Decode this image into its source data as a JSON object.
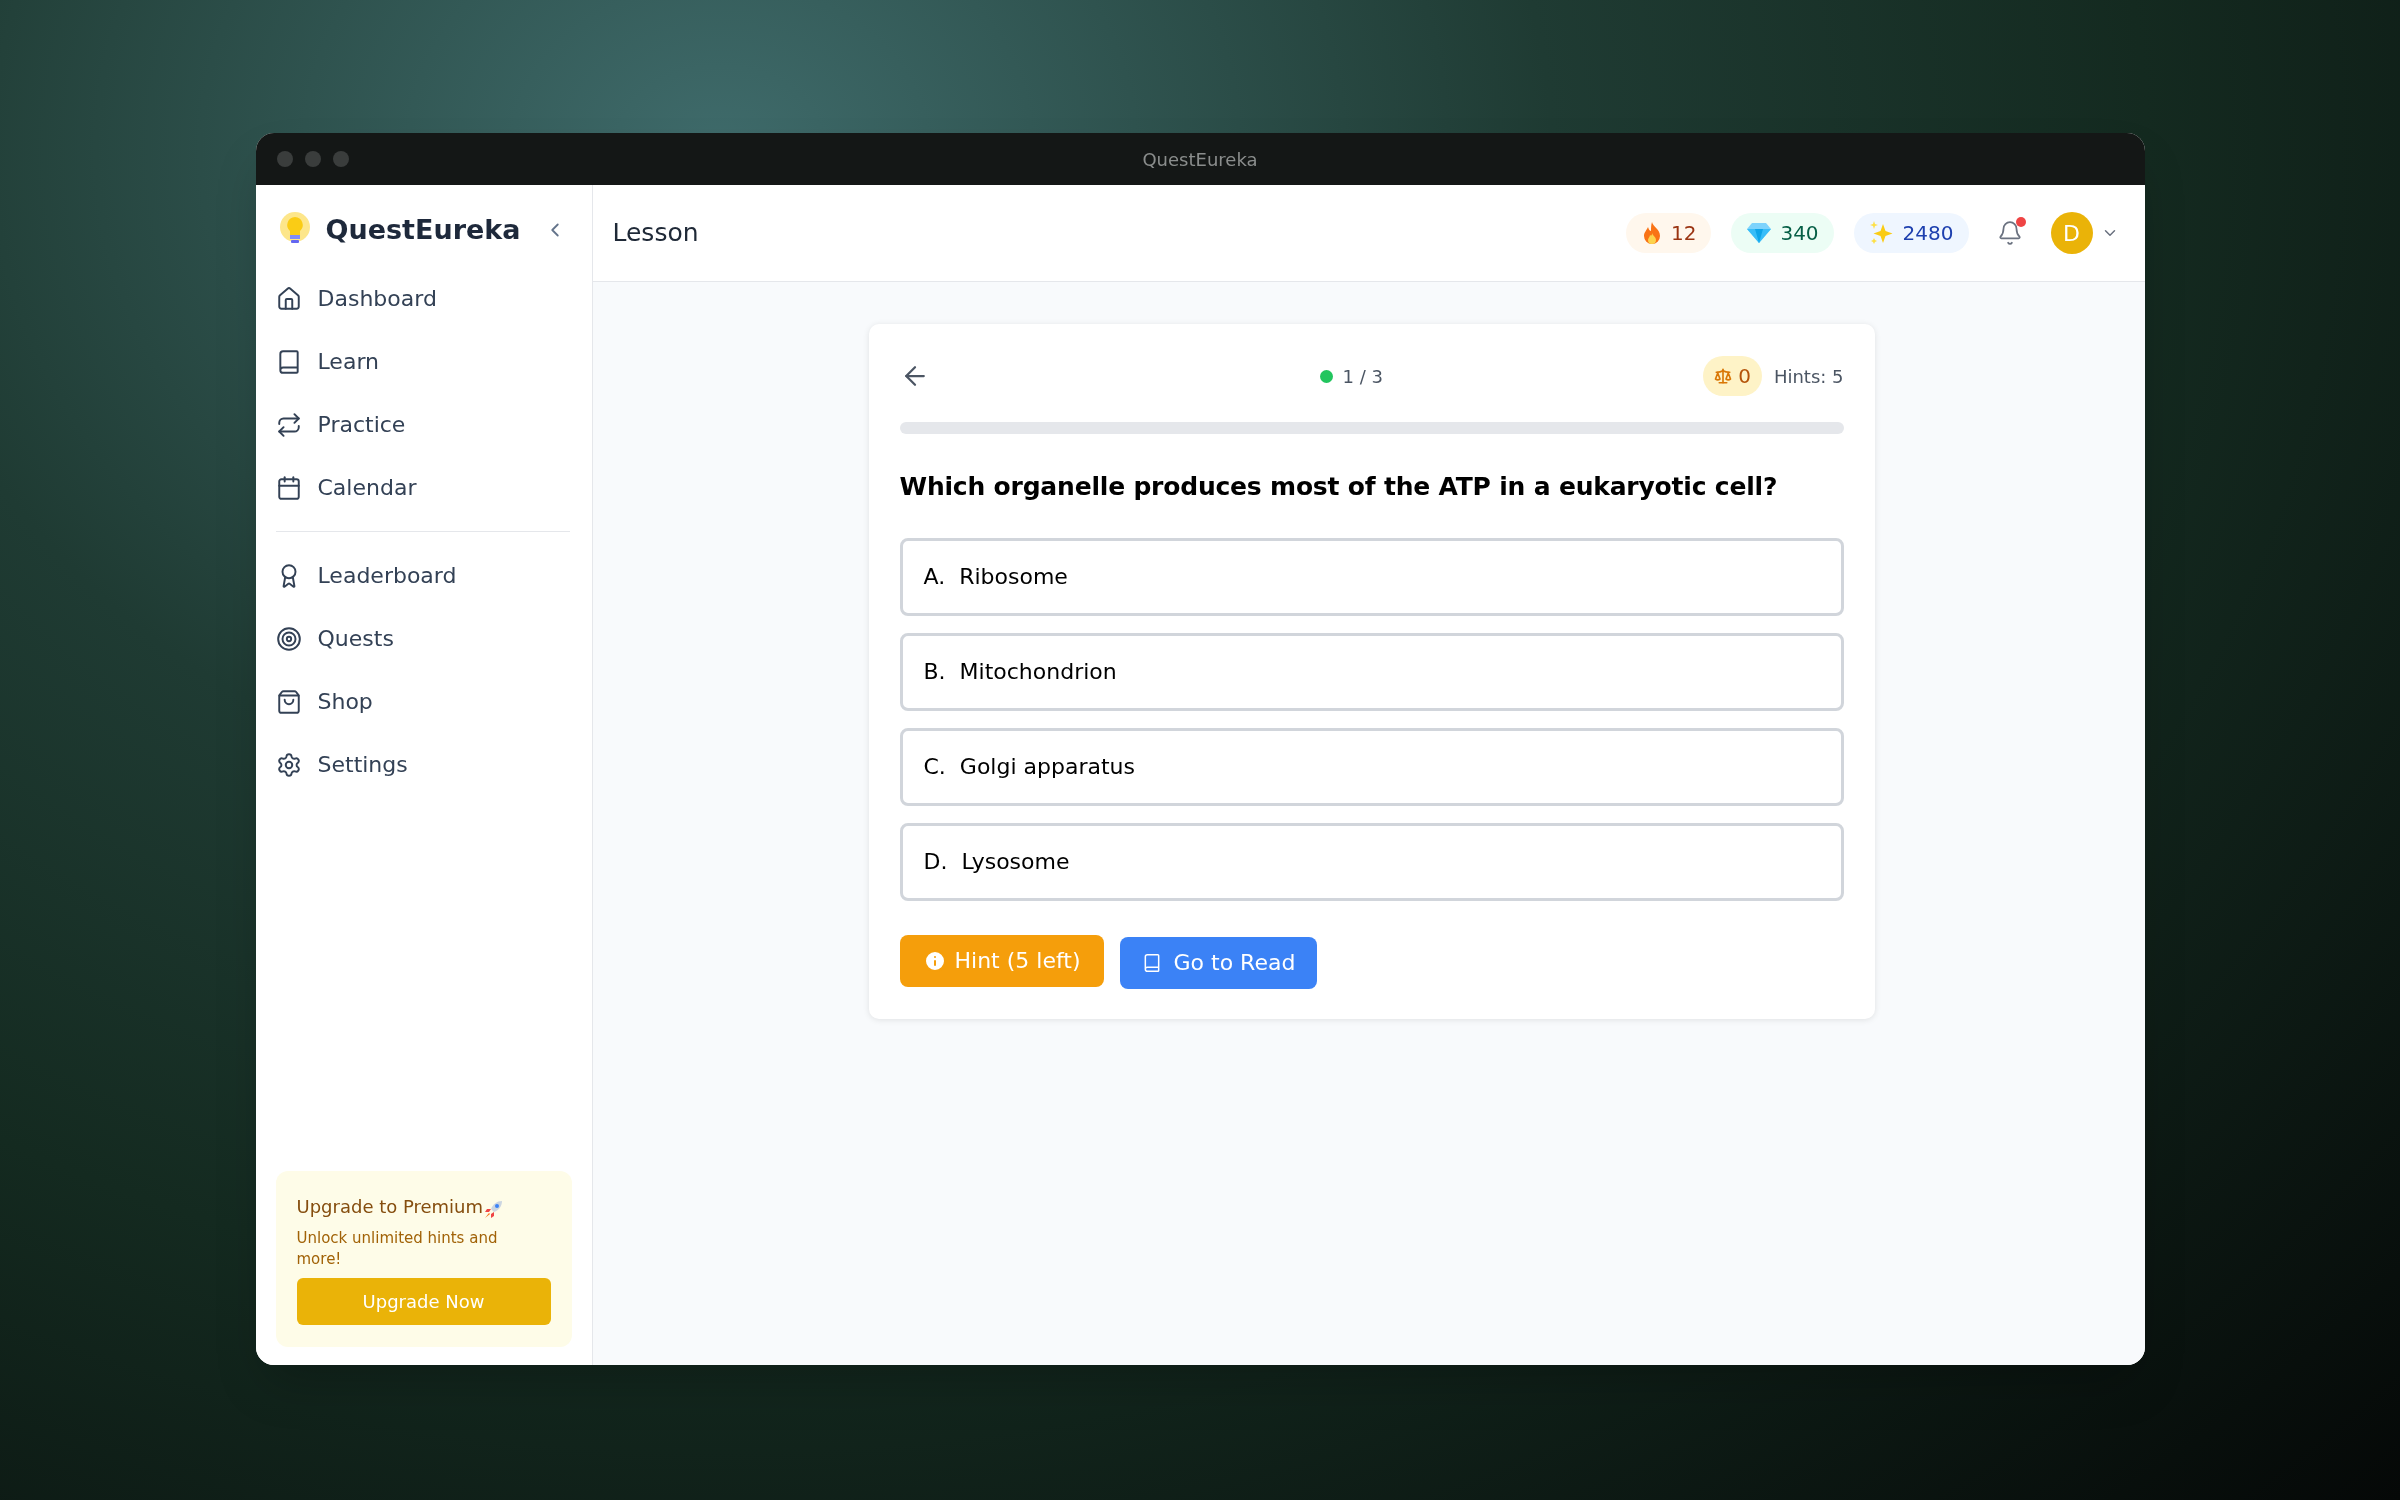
{
  "window": {
    "title": "QuestEureka"
  },
  "sidebar": {
    "brand": "QuestEureka",
    "items": [
      {
        "label": "Dashboard"
      },
      {
        "label": "Learn"
      },
      {
        "label": "Practice"
      },
      {
        "label": "Calendar"
      }
    ],
    "more_items": [
      {
        "label": "Leaderboard"
      },
      {
        "label": "Quests"
      },
      {
        "label": "Shop"
      },
      {
        "label": "Settings"
      }
    ],
    "promo": {
      "title": "Upgrade to Premium",
      "text": "Unlock unlimited hints and more!",
      "button": "Upgrade Now"
    }
  },
  "header": {
    "title": "Lesson",
    "stats": [
      {
        "kind": "streak",
        "value": "12"
      },
      {
        "kind": "gems",
        "value": "340"
      },
      {
        "kind": "xp",
        "value": "2480"
      }
    ],
    "notifications": {
      "unread": true
    },
    "avatar": "D"
  },
  "lesson": {
    "progress_label": "1 / 3",
    "badge": "0",
    "hints": "Hints: 5",
    "progress": {
      "level": 0
    },
    "question": "Which organelle produces most of the ATP in a eukaryotic cell?",
    "options": [
      {
        "letter": "A.",
        "text": "Ribosome"
      },
      {
        "letter": "B.",
        "text": "Mitochondrion"
      },
      {
        "letter": "C.",
        "text": "Golgi apparatus"
      },
      {
        "letter": "D.",
        "text": "Lysosome"
      }
    ],
    "buttons": [
      {
        "kind": "hint",
        "label": "Hint (5 left)"
      },
      {
        "kind": "read",
        "label": "Go to Read"
      }
    ]
  }
}
